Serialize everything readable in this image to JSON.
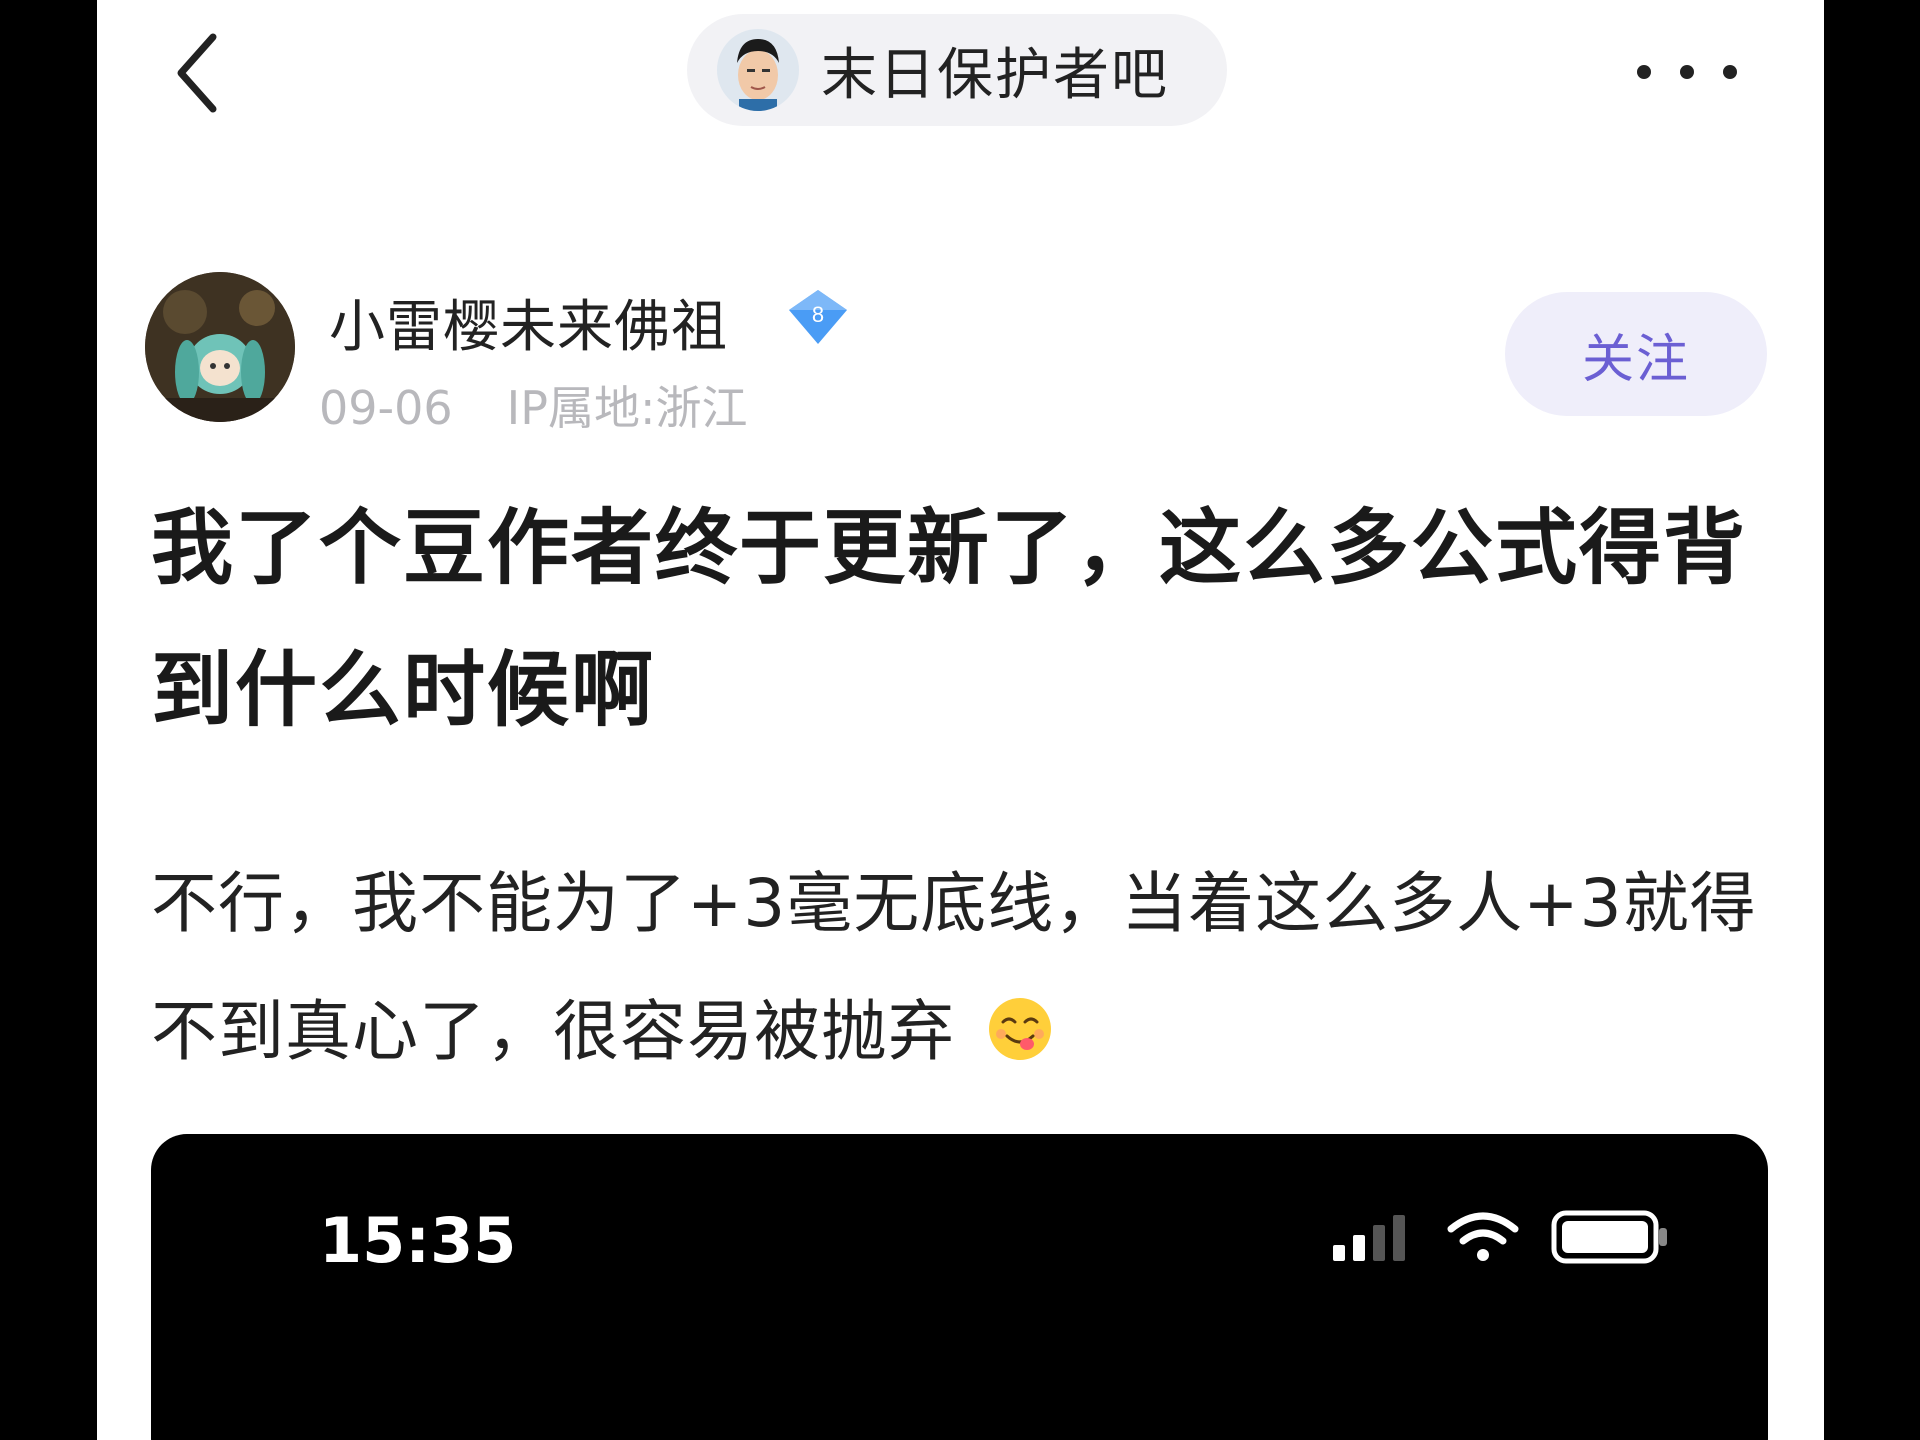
{
  "nav": {
    "forum_name": "末日保护者吧"
  },
  "author": {
    "name": "小雷樱未来佛祖",
    "level": "8",
    "date": "09-06",
    "ip_location": "IP属地:浙江",
    "follow_label": "关注"
  },
  "post": {
    "title": "我了个豆作者终于更新了，这么多公式得背到什么时候啊",
    "body": "不行，我不能为了+3毫无底线，当着这么多人+3就得不到真心了，很容易被抛弃"
  },
  "embed": {
    "time": "15:35"
  },
  "colors": {
    "accent": "#6b5fd3",
    "badge": "#4a9cf5",
    "meta": "#b8b8bc"
  }
}
